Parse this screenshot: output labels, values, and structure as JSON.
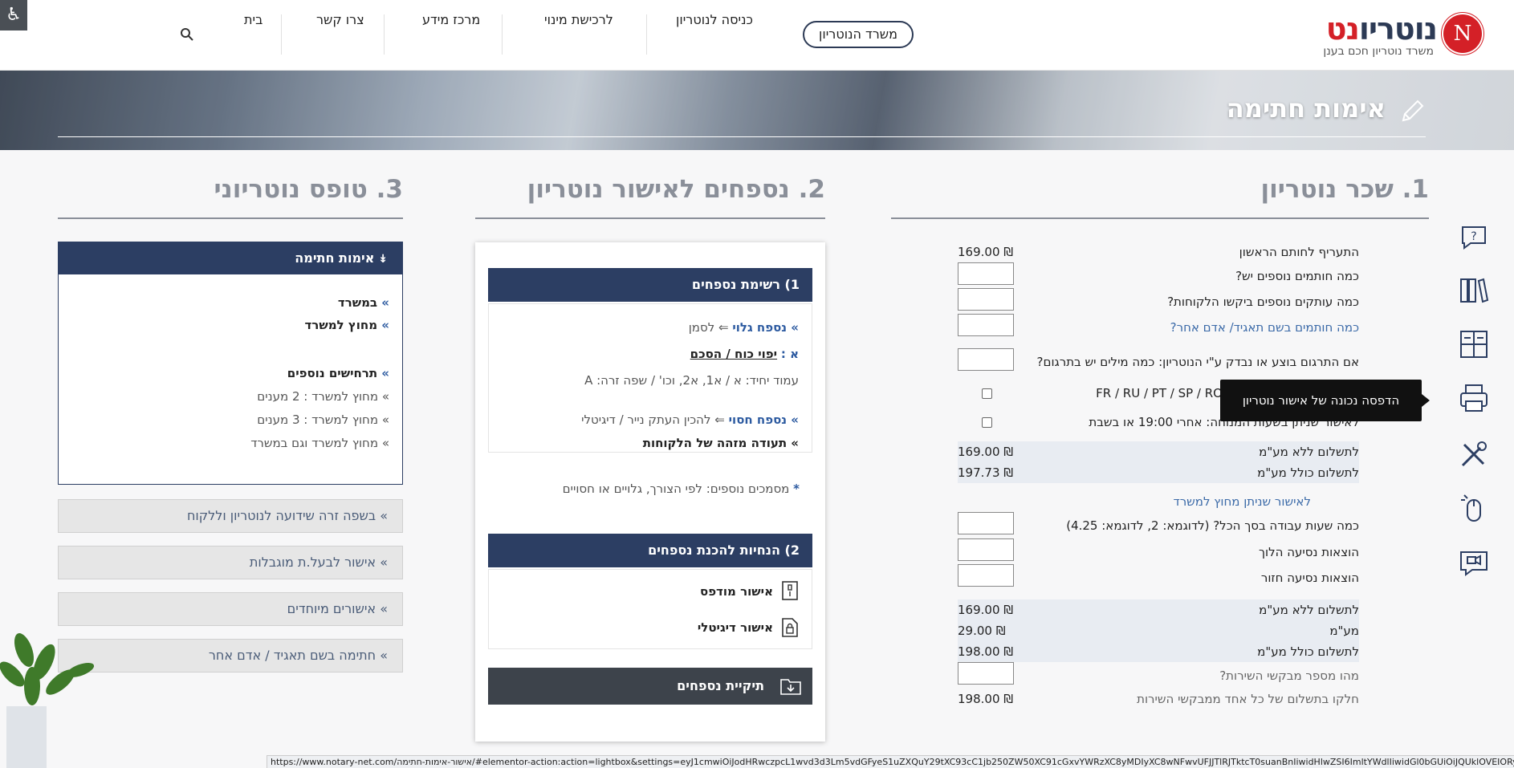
{
  "header": {
    "logo_part1": "נוטריו",
    "logo_part2": "נט",
    "logo_letter": "N",
    "logo_sub": "משרד נוטריון חכם בענן",
    "nav": {
      "office": "משרד הנוטריון",
      "login": "כניסה לנוטריון",
      "appointment": "לרכישת מינוי",
      "info": "מרכז מידע",
      "contact": "צרו קשר",
      "home": "בית"
    }
  },
  "banner": {
    "title": "אימות חתימה"
  },
  "sections": {
    "fees_title": "1. שכר נוטריון",
    "appendix_title": "2. נספחים לאישור נוטריון",
    "form_title": "3. טופס נוטריוני"
  },
  "fees": {
    "first_signer_label": "התעריף לחותם הראשון",
    "first_signer_value": "169.00 ₪",
    "extra_signers": "כמה חותמים נוספים יש?",
    "extra_copies": "כמה עותקים נוספים ביקשו הלקוחות?",
    "signers_on_behalf": "כמה חותמים בשם תאגיד/ אדם אחר?",
    "translation": "אם התרגום בוצע או נבדק ע\"י הנוטריון: כמה מילים יש בתרגום?",
    "languages": "FR / RU / PT / SP / RO / LT",
    "after_hours": "לאישור שניתן בשעות המנוחה: אחרי 19:00 או בשבת",
    "total_no_vat_label": "לתשלום ללא מע\"מ",
    "total_no_vat_value": "169.00 ₪",
    "total_vat_label": "לתשלום כולל מע\"מ",
    "total_vat_value": "197.73 ₪",
    "outside_office": "לאישור שניתן מחוץ למשרד",
    "work_hours": "כמה שעות עבודה בסך הכל? (לדוגמא: 2, לדוגמא: 4.25)",
    "travel_out": "הוצאות נסיעה הלוך",
    "travel_back": "הוצאות נסיעה חזור",
    "total2_no_vat_label": "לתשלום ללא מע\"מ",
    "total2_no_vat_value": "169.00 ₪",
    "vat_label": "מע\"מ",
    "vat_value": "29.00 ₪",
    "total2_vat_label": "לתשלום כולל מע\"מ",
    "total2_vat_value": "198.00 ₪",
    "requesters": "מהו מספר מבקשי השירות?",
    "share_label": "חלקו בתשלום של כל אחד ממבקשי השירות",
    "share_value": "198.00 ₪"
  },
  "tooltip": "הדפסה נכונה של אישור נוטריון",
  "appendix": {
    "list_header": "1) רשימת נספחים",
    "visible_appendix": "» נספח גלוי",
    "visible_appendix_rest": " ⇐ לסמן",
    "item_a": "א :",
    "item_a_text": "יפוי כוח / הסכם",
    "single_page": "עמוד יחיד: א / א1, א2, וכו' / שפה זרה: A",
    "hidden_appendix": "» נספח חסוי",
    "hidden_appendix_rest": " ⇐ להכין העתק נייר / דיגיטלי",
    "id_doc": "» תעודה מזהה של הלקוחות",
    "additional_docs": " מסמכים נוספים: לפי הצורך, גלויים או חסויים",
    "asterisk": "*",
    "guide_header": "2) הנחיות להכנת נספחים",
    "printed": "אישור מודפס",
    "digital": "אישור דיגיטלי",
    "folder": "תיקיית נספחים"
  },
  "form": {
    "open_header": "אימות חתימה",
    "in_office": "במשרד",
    "outside_office": "מחוץ למשרד",
    "extra_scenarios": "תרחישים נוספים",
    "out_2": "מחוץ למשרד : 2 מענים",
    "out_3": "מחוץ למשרד : 3 מענים",
    "out_and_in": "מחוץ למשרד וגם במשרד",
    "foreign_lang": "בשפה זרה שידועה לנוטריון וללקוח",
    "disabled": "אישור לבעל.ת מוגבלות",
    "special": "אישורים מיוחדים",
    "on_behalf": "חתימה בשם תאגיד / אדם אחר"
  },
  "status_url": "https://www.notary-net.com/אישור-אימות-חתימה/#elementor-action:action=lightbox&settings=eyJ1cmwiOiJodHRwczpcL1wvd3d3Lm5vdGFyeS1uZXQuY29tXC93cC1jb250ZW50XC91cGxvYWRzXC8yMDIyXC8wNFwvUFJJTlRJTktcT0suanBnIiwidHlwZSI6ImltYWdlIiwidGl0bGUiOiJQUklOVEIORyBPS",
  "colors": {
    "navy": "#2c3e63",
    "red": "#d42027",
    "link": "#3b6aa8"
  },
  "icons": [
    "accessibility-icon",
    "search-icon",
    "pen-icon",
    "question-icon",
    "books-icon",
    "calculator-icon",
    "printer-icon",
    "tools-icon",
    "mouse-icon",
    "video-icon",
    "printed-doc-icon",
    "digital-doc-icon",
    "folder-download-icon"
  ]
}
